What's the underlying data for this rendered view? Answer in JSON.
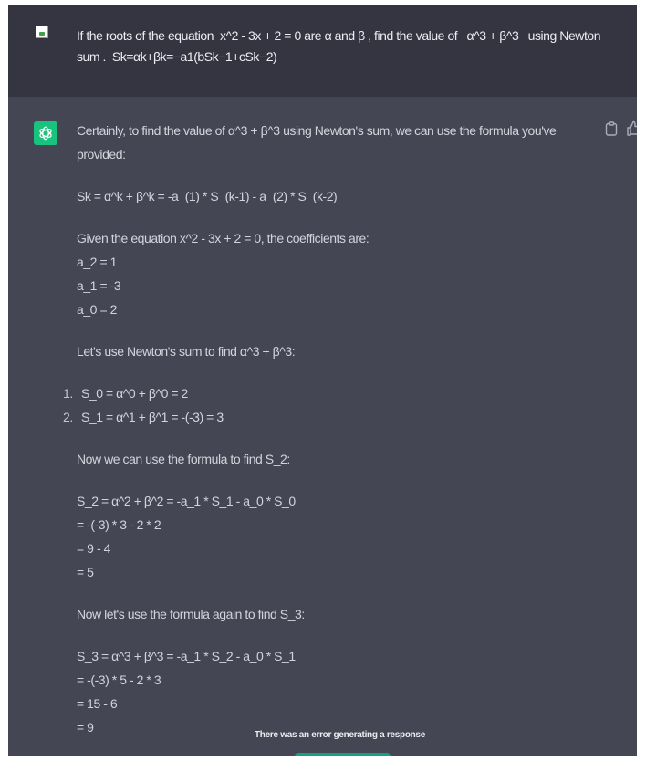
{
  "user_message": {
    "text": "If the roots of the equation  x^2 - 3x + 2 = 0 are α and β , find the value of   α^3 + β^3   using Newton sum .  Sk=αk+βk=−a1(bSk−1+cSk−2)"
  },
  "assistant_message": {
    "intro": "Certainly, to find the value of α^3 + β^3 using Newton's sum, we can use the formula you've provided:",
    "formula": "Sk = α^k + β^k = -a_(1) * S_(k-1) - a_(2) * S_(k-2)",
    "given": "Given the equation x^2 - 3x + 2 = 0, the coefficients are:",
    "coefficients": [
      "a_2 = 1",
      "a_1 = -3",
      "a_0 = 2"
    ],
    "lets_use": "Let's use Newton's sum to find α^3 + β^3:",
    "steps": [
      {
        "num": "1.",
        "text": "S_0 = α^0 + β^0 = 2"
      },
      {
        "num": "2.",
        "text": "S_1 = α^1 + β^1 = -(-3) = 3"
      }
    ],
    "now_s2": "Now we can use the formula to find S_2:",
    "s2_lines": [
      "S_2 = α^2 + β^2 = -a_1 * S_1 - a_0 * S_0",
      "= -(-3) * 3 - 2 * 2",
      "= 9 - 4",
      "= 5"
    ],
    "now_s3": "Now let's use the formula again to find S_3:",
    "s3_lines": [
      "S_3 = α^3 + β^3 = -a_1 * S_2 - a_0 * S_1",
      "= -(-3) * 5 - 2 * 3",
      "= 15 - 6",
      "= 9"
    ]
  },
  "error": {
    "text": "There was an error generating a response"
  },
  "icons": {
    "avatar_user": "broken-image-icon",
    "avatar_assistant": "openai-logo-icon",
    "copy": "clipboard-icon",
    "feedback": "thumbs-up-icon"
  },
  "colors": {
    "user_bg": "#343541",
    "assistant_bg": "#444654",
    "accent": "#19c37d",
    "regenerate": "#10a37f"
  }
}
